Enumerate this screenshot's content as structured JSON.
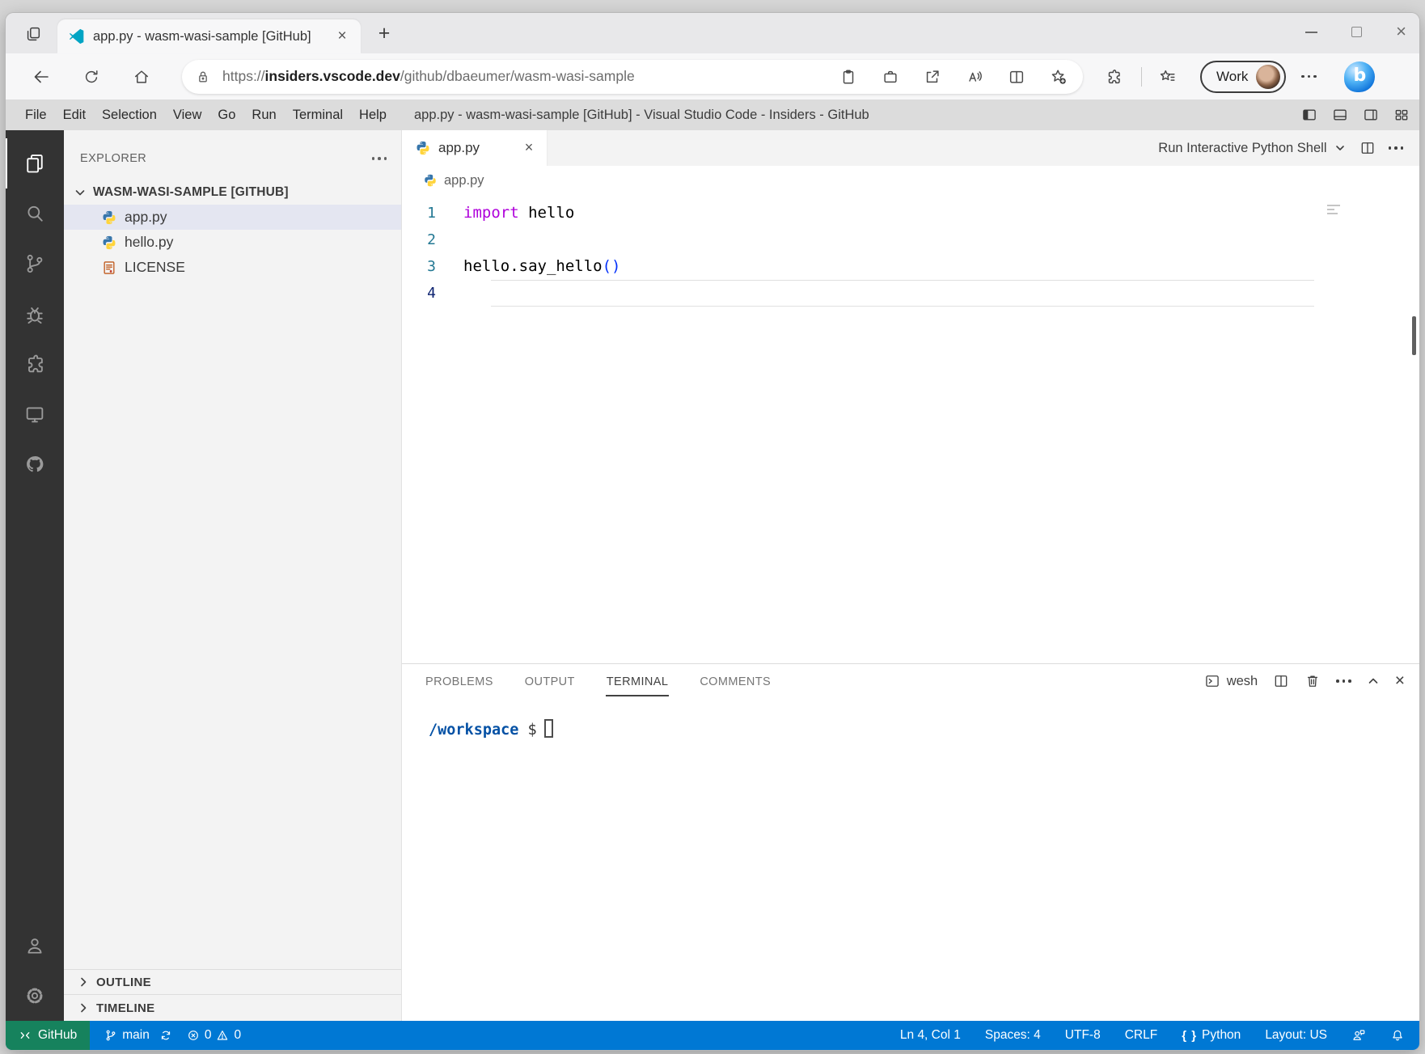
{
  "browser": {
    "tab": {
      "title": "app.py - wasm-wasi-sample [GitHub]"
    },
    "address": {
      "scheme": "https://",
      "domain": "insiders.vscode.dev",
      "path": "/github/dbaeumer/wasm-wasi-sample"
    },
    "profile": {
      "label": "Work"
    }
  },
  "titlebar": {
    "menus": [
      "File",
      "Edit",
      "Selection",
      "View",
      "Go",
      "Run",
      "Terminal",
      "Help"
    ],
    "title": "app.py - wasm-wasi-sample [GitHub] - Visual Studio Code - Insiders - GitHub"
  },
  "explorer": {
    "title": "EXPLORER",
    "section": "WASM-WASI-SAMPLE [GITHUB]",
    "files": [
      {
        "name": "app.py"
      },
      {
        "name": "hello.py"
      },
      {
        "name": "LICENSE"
      }
    ],
    "outline": "OUTLINE",
    "timeline": "TIMELINE"
  },
  "editor": {
    "tab": "app.py",
    "breadcrumb": "app.py",
    "action": "Run Interactive Python Shell",
    "lines": [
      {
        "num": "1",
        "kw": "import",
        "plain": " hello",
        "bracket": ""
      },
      {
        "num": "2",
        "kw": "",
        "plain": "",
        "bracket": ""
      },
      {
        "num": "3",
        "kw": "",
        "plain": "hello.say_hello",
        "bracket": "()"
      },
      {
        "num": "4",
        "kw": "",
        "plain": "",
        "bracket": ""
      }
    ]
  },
  "panel": {
    "tabs": [
      {
        "label": "PROBLEMS"
      },
      {
        "label": "OUTPUT"
      },
      {
        "label": "TERMINAL"
      },
      {
        "label": "COMMENTS"
      }
    ],
    "shell_label": "wesh",
    "prompt": {
      "path": "/workspace",
      "symbol": " $"
    }
  },
  "status": {
    "remote": "GitHub",
    "branch": "main",
    "errors": "0",
    "warnings": "0",
    "line_col": "Ln 4, Col 1",
    "indent": "Spaces: 4",
    "encoding": "UTF-8",
    "eol": "CRLF",
    "language": "Python",
    "layout": "Layout: US"
  },
  "icons": {
    "close_glyph": "×",
    "plus_glyph": "+",
    "brace_glyph": "{ }"
  },
  "colors": {
    "accent": "#0078d4",
    "remote_badge": "#16825d",
    "keyword": "#af00db",
    "bracket": "#0431fa",
    "terminal_path": "#0451a5"
  }
}
